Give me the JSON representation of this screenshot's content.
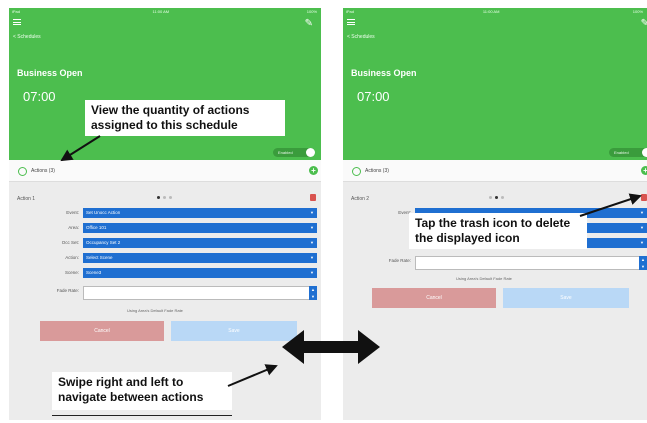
{
  "left_screen": {
    "status": {
      "carrier": "iPad",
      "time": "11:00 AM",
      "battery": "100%"
    },
    "breadcrumb": "< Schedules",
    "schedule_name": "Business Open",
    "schedule_time": "07:00",
    "toggle_label": "Enabled",
    "actions_label": "Actions (3)",
    "action_title": "Action 1",
    "fields": [
      {
        "label": "Event:",
        "value": "Set Unocc Action"
      },
      {
        "label": "Area:",
        "value": "Office 101"
      },
      {
        "label": "Occ Set:",
        "value": "Occupancy Set 2"
      },
      {
        "label": "Action:",
        "value": "Select Scene"
      },
      {
        "label": "Scene:",
        "value": "Scene3"
      }
    ],
    "fade_label": "Fade Rate:",
    "fade_hint": "Using Area's Default Fade Rate",
    "cancel_label": "Cancel",
    "save_label": "Save"
  },
  "right_screen": {
    "status": {
      "carrier": "iPad",
      "time": "11:00 AM",
      "battery": "100%"
    },
    "breadcrumb": "< Schedules",
    "schedule_name": "Business Open",
    "schedule_time": "07:00",
    "toggle_label": "Enabled",
    "actions_label": "Actions (3)",
    "action_title": "Action 2",
    "fields": [
      {
        "label": "Event:",
        "value": ""
      },
      {
        "label": "",
        "value": ""
      },
      {
        "label": "",
        "value": ""
      }
    ],
    "fade_label": "Fade Rate:",
    "fade_hint": "Using Area's Default Fade Rate",
    "cancel_label": "Cancel",
    "save_label": "Save"
  },
  "callouts": {
    "quantity": "View the quantity of actions assigned to this schedule",
    "trash": "Tap the trash icon to delete the displayed icon",
    "swipe": "Swipe right and left to navigate between actions"
  },
  "colors": {
    "header_green": "#4cbe4e",
    "select_blue": "#1f6fd1",
    "trash_red": "#d9534f",
    "cancel_pink": "#d99a9a",
    "save_lightblue": "#b9d8f6"
  },
  "icons": [
    "hamburger-icon",
    "pencil-icon",
    "clock-icon",
    "add-icon",
    "trash-icon",
    "chevron-down-icon",
    "stepper-icon",
    "double-arrow-icon"
  ]
}
